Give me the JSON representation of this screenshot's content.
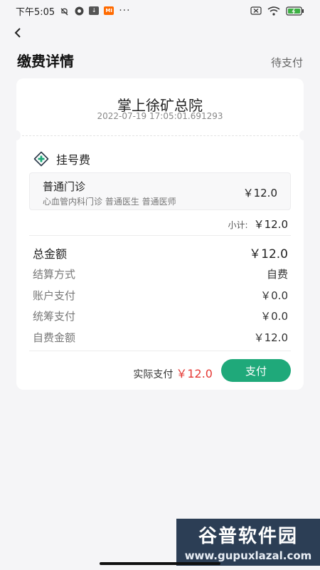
{
  "status_bar": {
    "time": "下午5:05",
    "mi_badge": "MI",
    "more": "···"
  },
  "header": {
    "title": "缴费详情",
    "status": "待支付"
  },
  "hospital": {
    "name": "掌上徐矿总院",
    "timestamp": "2022-07-19 17:05:01.691293"
  },
  "section": {
    "title": "挂号费",
    "items": [
      {
        "name": "普通门诊",
        "desc": "心血管内科门诊 普通医生 普通医师",
        "price": "￥12.0"
      }
    ],
    "subtotal_label": "小计:",
    "subtotal_value": "￥12.0"
  },
  "summary": [
    {
      "label": "总金额",
      "value": "￥12.0"
    },
    {
      "label": "结算方式",
      "value": "自费"
    },
    {
      "label": "账户支付",
      "value": "￥0.0"
    },
    {
      "label": "统筹支付",
      "value": "￥0.0"
    },
    {
      "label": "自费金额",
      "value": "￥12.0"
    }
  ],
  "footer": {
    "actual_label": "实际支付",
    "actual_value": "￥12.0",
    "pay_button": "支付"
  },
  "watermark": {
    "title": "谷普软件园",
    "url": "www.gupuxlazal.com"
  },
  "colors": {
    "accent": "#1fa97a",
    "price_red": "#e53935"
  }
}
